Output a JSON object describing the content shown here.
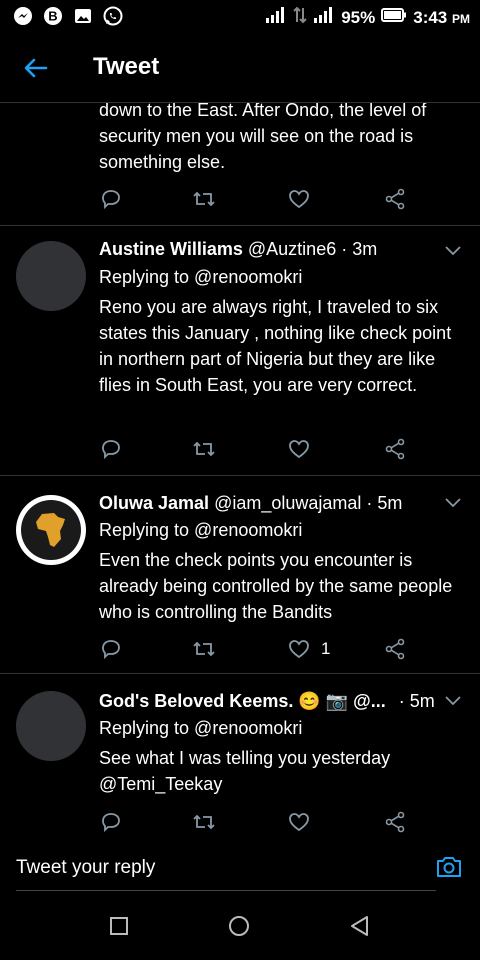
{
  "statusbar": {
    "battery": "95%",
    "time": "3:43",
    "ampm": "PM",
    "left_icons": [
      "messenger-icon",
      "b-app-icon",
      "gallery-icon",
      "whatsapp-icon"
    ]
  },
  "appbar": {
    "title": "Tweet"
  },
  "tweets": [
    {
      "body": "down to the East. After Ondo, the level of security men you will see on the road is something else.",
      "likes": ""
    },
    {
      "name": "Austine Williams",
      "meta": "@Auztine6 · 3m",
      "replying": "Replying to @renoomokri",
      "body": "Reno you are always right, I traveled to six states this January , nothing like check point in northern part of Nigeria  but they are like flies in South East, you are very correct.",
      "likes": ""
    },
    {
      "name": "Oluwa Jamal",
      "meta": "@iam_oluwajamal · 5m",
      "replying": "Replying to @renoomokri",
      "body": "Even the check points you encounter is already being controlled by the same people who is controlling the Bandits",
      "likes": "1"
    },
    {
      "name": "God's Beloved Keems. 😊 📷 @...",
      "meta": "· 5m",
      "replying": "Replying to @renoomokri",
      "body": "See what I was telling you yesterday @Temi_Teekay",
      "likes": ""
    }
  ],
  "composer": {
    "placeholder": "Tweet your reply"
  },
  "colors": {
    "accent": "#1da1f2",
    "icon": "#8899a6",
    "divider": "#2f3336"
  }
}
